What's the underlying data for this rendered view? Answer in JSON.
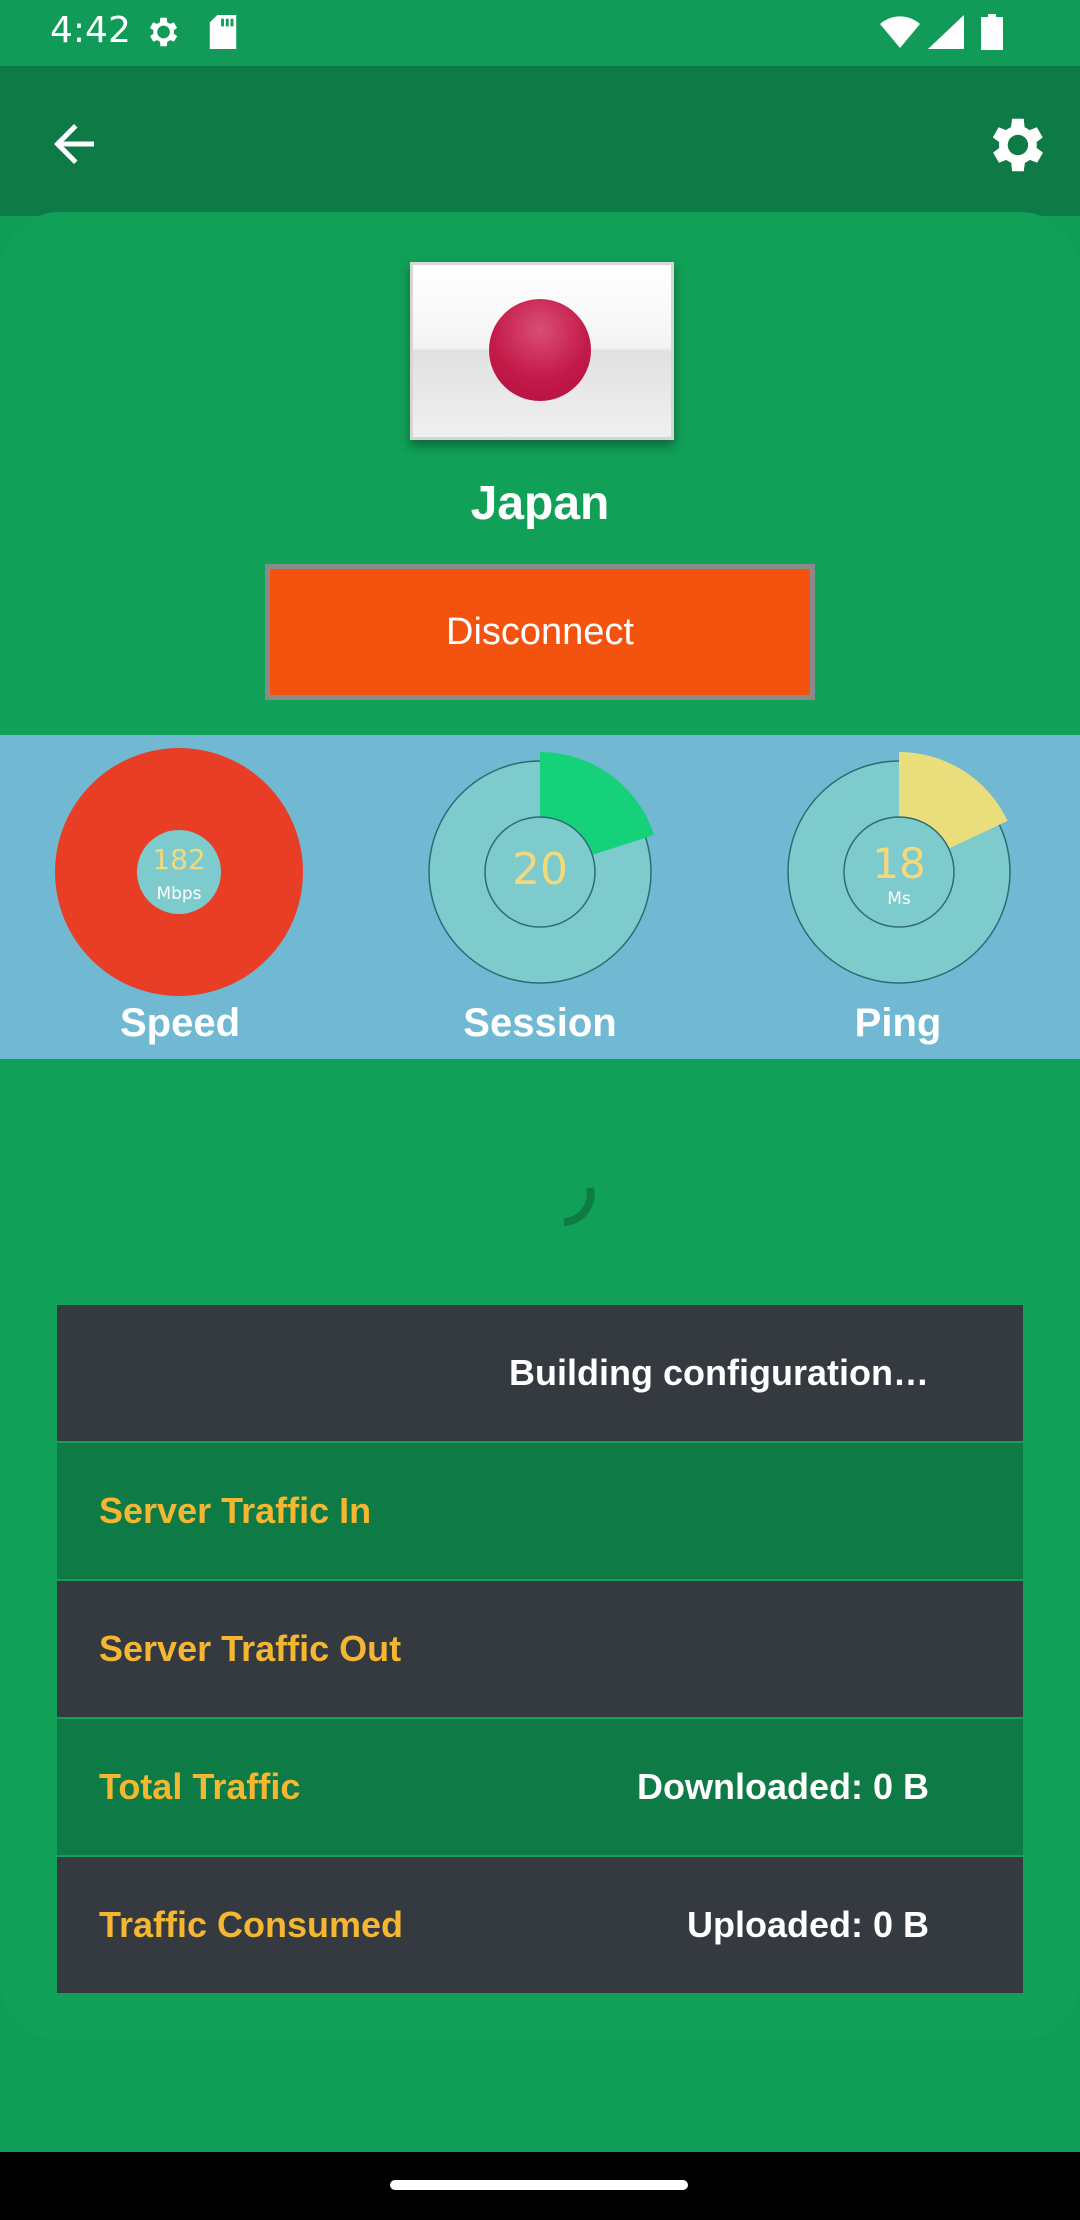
{
  "status_bar": {
    "time": "4:42",
    "icons": [
      "settings-notification-icon",
      "sd-card-icon",
      "wifi-icon",
      "signal-icon",
      "battery-icon"
    ]
  },
  "app_bar": {
    "icons": [
      "arrow-back-icon",
      "gear-icon"
    ]
  },
  "server": {
    "flag": "japan-flag",
    "country": "Japan",
    "button_label": "Disconnect"
  },
  "gauges": [
    {
      "label": "Speed",
      "value": "182",
      "unit": "Mbps",
      "fill_fraction": 1.0,
      "color": "#e83e26"
    },
    {
      "label": "Session",
      "value": "20",
      "unit": "",
      "fill_fraction": 0.2,
      "color": "#15d27a"
    },
    {
      "label": "Ping",
      "value": "18",
      "unit": "Ms",
      "fill_fraction": 0.18,
      "color": "#eadd7c"
    }
  ],
  "status_rows": [
    {
      "label": "",
      "value": "Building configuration…"
    },
    {
      "label": "Server Traffic In",
      "value": ""
    },
    {
      "label": "Server Traffic Out",
      "value": ""
    },
    {
      "label": "Total Traffic",
      "value": "Downloaded: 0 B"
    },
    {
      "label": "Traffic Consumed",
      "value": "Uploaded: 0 B"
    }
  ],
  "colors": {
    "primary_green": "#0f9d58",
    "dark_green": "#0e7a45",
    "accent_orange": "#f3530e",
    "label_yellow": "#f5b731",
    "panel_blue": "#71b9d3",
    "row_dark": "#353a40"
  }
}
